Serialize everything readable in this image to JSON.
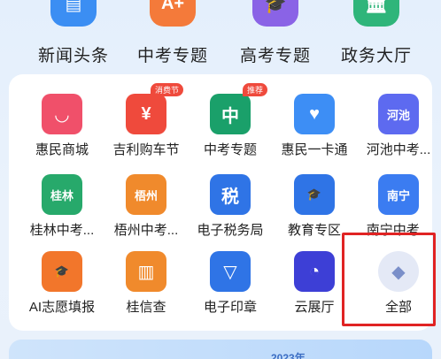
{
  "top_row": [
    {
      "label": "新闻头条",
      "icon": "news-icon",
      "glyph": "▤",
      "color": "#3b8ef3"
    },
    {
      "label": "中考专题",
      "icon": "grade-icon",
      "glyph": "A+",
      "color": "#f47a3a"
    },
    {
      "label": "高考专题",
      "icon": "graduation-cap-icon",
      "glyph": "🎓",
      "color": "#8a63e6"
    },
    {
      "label": "政务大厅",
      "icon": "government-building-icon",
      "glyph": "🏛",
      "color": "#2fb57a"
    }
  ],
  "grid": [
    {
      "label": "惠民商城",
      "icon": "shopping-bag-icon",
      "glyph": "◡",
      "color": "#f0506a",
      "tag": ""
    },
    {
      "label": "吉利购车节",
      "icon": "car-purchase-icon",
      "glyph": "¥",
      "color": "#ef4a3c",
      "tag": "消费节",
      "tag_color": "#ef4a3c"
    },
    {
      "label": "中考专题",
      "icon": "exam-search-icon",
      "glyph": "中",
      "color": "#1aa06a",
      "tag": "推荐",
      "tag_color": "#ef4a3c"
    },
    {
      "label": "惠民一卡通",
      "icon": "card-heart-icon",
      "glyph": "♥",
      "color": "#3d8ef5",
      "tag": ""
    },
    {
      "label": "河池中考...",
      "icon": "hechi-exam-icon",
      "glyph": "河池",
      "color": "#5d6af0",
      "tag": ""
    },
    {
      "label": "桂林中考...",
      "icon": "guilin-exam-icon",
      "glyph": "桂林",
      "color": "#27a96b",
      "tag": ""
    },
    {
      "label": "梧州中考...",
      "icon": "wuzhou-exam-icon",
      "glyph": "梧州",
      "color": "#f08a2c",
      "tag": ""
    },
    {
      "label": "电子税务局",
      "icon": "tax-icon",
      "glyph": "税",
      "color": "#2f74e6",
      "tag": ""
    },
    {
      "label": "教育专区",
      "icon": "education-cap-icon",
      "glyph": "🎓",
      "color": "#2f74e6",
      "tag": ""
    },
    {
      "label": "南宁中考...",
      "icon": "nanning-exam-icon",
      "glyph": "南宁",
      "color": "#3b7cf1",
      "tag": ""
    },
    {
      "label": "AI志愿填报",
      "icon": "ai-volunteer-icon",
      "glyph": "🎓",
      "color": "#f2762b",
      "tag": ""
    },
    {
      "label": "桂信查",
      "icon": "credit-check-icon",
      "glyph": "▥",
      "color": "#f08a2c",
      "tag": ""
    },
    {
      "label": "电子印章",
      "icon": "seal-icon",
      "glyph": "▽",
      "color": "#2f74e6",
      "tag": ""
    },
    {
      "label": "云展厅",
      "icon": "cloud-exhibition-icon",
      "glyph": "◔",
      "color": "#3d3fd6",
      "tag": ""
    },
    {
      "label": "全部",
      "icon": "all-apps-icon",
      "glyph": "◆",
      "color": "#e4e9f6",
      "tag": ""
    }
  ],
  "banner": {
    "text": "2023年"
  }
}
